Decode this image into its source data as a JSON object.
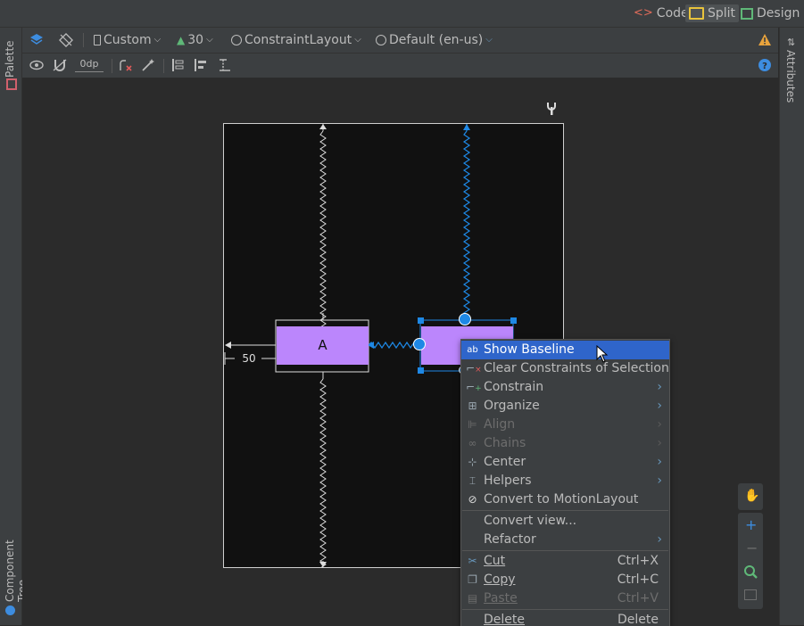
{
  "header": {
    "modes": [
      {
        "label": "Code",
        "icon": "code-icon"
      },
      {
        "label": "Split",
        "icon": "split-icon"
      },
      {
        "label": "Design",
        "icon": "design-icon"
      }
    ]
  },
  "left_strip": {
    "palette": "Palette",
    "component_tree": "Component Tree"
  },
  "right_strip": {
    "attributes": "Attributes"
  },
  "toolbar": {
    "device": "Custom",
    "api": "30",
    "layout": "ConstraintLayout",
    "locale": "Default (en-us)",
    "margin": "0dp"
  },
  "canvas": {
    "button_a": "A",
    "margin_label": "50"
  },
  "context_menu": {
    "items": [
      {
        "label": "Show Baseline",
        "icon": "baseline-icon"
      },
      {
        "label": "Clear Constraints of Selection",
        "icon": "clear-constraints-icon"
      },
      {
        "label": "Constrain",
        "icon": "constrain-icon"
      },
      {
        "label": "Organize",
        "icon": "organize-icon"
      },
      {
        "label": "Align",
        "icon": "align-icon"
      },
      {
        "label": "Chains",
        "icon": "chains-icon"
      },
      {
        "label": "Center",
        "icon": "center-icon"
      },
      {
        "label": "Helpers",
        "icon": "helpers-icon"
      },
      {
        "label": "Convert to MotionLayout",
        "icon": "motionlayout-icon"
      },
      {
        "label": "Convert view..."
      },
      {
        "label": "Refactor"
      },
      {
        "label": "Cut",
        "shortcut": "Ctrl+X",
        "icon": "scissors-icon"
      },
      {
        "label": "Copy",
        "shortcut": "Ctrl+C",
        "icon": "copy-icon"
      },
      {
        "label": "Paste",
        "shortcut": "Ctrl+V",
        "icon": "paste-icon"
      },
      {
        "label": "Delete",
        "shortcut": "Delete"
      }
    ]
  },
  "colors": {
    "accent": "#2f65ca",
    "purple": "#bb86fc",
    "blueprint": "#1e88e5"
  }
}
